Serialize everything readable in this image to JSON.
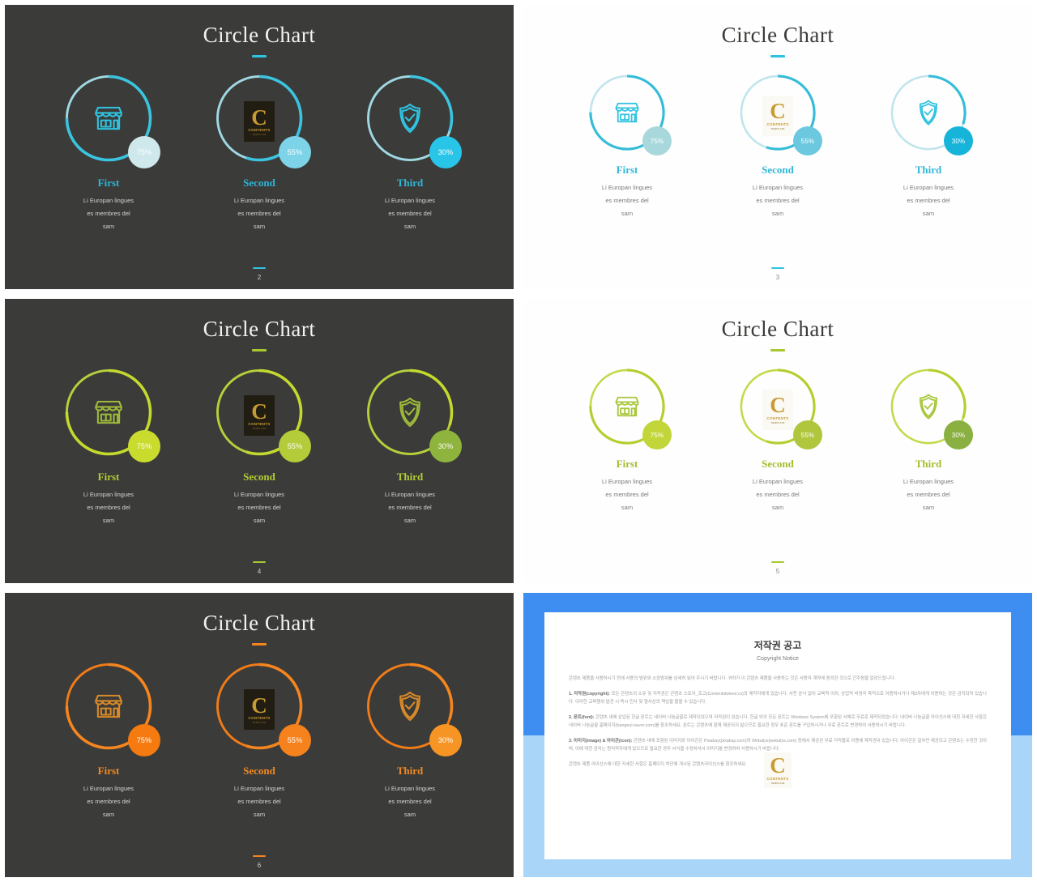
{
  "slides": [
    {
      "id": "slide-2-dark-cyan",
      "theme": "dark",
      "title": "Circle Chart",
      "accent": "#2fc3e0",
      "page": "2",
      "ring_track": "#9fd8e2",
      "ring_fill": "#3bc4e0",
      "name_color": "#2fb6d6",
      "icon_color": "#2fc3e0",
      "items": [
        {
          "name": "First",
          "percent": "75%",
          "icon": "storefront-icon",
          "badge": "#cfe8ec",
          "desc": [
            "Li Europan lingues",
            "es membres del",
            "sam"
          ]
        },
        {
          "name": "Second",
          "percent": "55%",
          "icon": "line-chart-icon",
          "badge": "#7dd3e8",
          "desc": [
            "Li Europan lingues",
            "es membres del",
            "sam"
          ]
        },
        {
          "name": "Third",
          "percent": "30%",
          "icon": "shield-check-icon",
          "badge": "#29c5e8",
          "desc": [
            "Li Europan lingues",
            "es membres del",
            "sam"
          ]
        }
      ]
    },
    {
      "id": "slide-3-light-cyan",
      "theme": "light",
      "title": "Circle Chart",
      "accent": "#2fc3e0",
      "page": "3",
      "ring_track": "#bfe5ec",
      "ring_fill": "#35bcd8",
      "name_color": "#33b8d8",
      "icon_color": "#2fc3e0",
      "items": [
        {
          "name": "First",
          "percent": "75%",
          "icon": "storefront-icon",
          "badge": "#a8d8dc",
          "desc": [
            "Li Europan lingues",
            "es membres del",
            "sam"
          ]
        },
        {
          "name": "Second",
          "percent": "55%",
          "icon": "line-chart-icon",
          "badge": "#6cc8de",
          "desc": [
            "Li Europan lingues",
            "es membres del",
            "sam"
          ]
        },
        {
          "name": "Third",
          "percent": "30%",
          "icon": "shield-check-icon",
          "badge": "#17b4da",
          "desc": [
            "Li Europan lingues",
            "es membres del",
            "sam"
          ]
        }
      ]
    },
    {
      "id": "slide-4-dark-green",
      "theme": "dark",
      "title": "Circle Chart",
      "accent": "#a8c832",
      "page": "4",
      "ring_track": "#b6cf3c",
      "ring_fill": "#c4d92e",
      "name_color": "#b3cc34",
      "icon_color": "#9db93a",
      "items": [
        {
          "name": "First",
          "percent": "75%",
          "icon": "storefront-icon",
          "badge": "#c9dc2e",
          "desc": [
            "Li Europan lingues",
            "es membres del",
            "sam"
          ]
        },
        {
          "name": "Second",
          "percent": "55%",
          "icon": "line-chart-icon",
          "badge": "#b4cb3a",
          "desc": [
            "Li Europan lingues",
            "es membres del",
            "sam"
          ]
        },
        {
          "name": "Third",
          "percent": "30%",
          "icon": "shield-check-icon",
          "badge": "#8fb43e",
          "desc": [
            "Li Europan lingues",
            "es membres del",
            "sam"
          ]
        }
      ]
    },
    {
      "id": "slide-5-light-green",
      "theme": "light",
      "title": "Circle Chart",
      "accent": "#a8c832",
      "page": "5",
      "ring_track": "#c3d94a",
      "ring_fill": "#b5cd2e",
      "name_color": "#a5bd2e",
      "icon_color": "#a8c63a",
      "items": [
        {
          "name": "First",
          "percent": "75%",
          "icon": "storefront-icon",
          "badge": "#c2d63a",
          "desc": [
            "Li Europan lingues",
            "es membres del",
            "sam"
          ]
        },
        {
          "name": "Second",
          "percent": "55%",
          "icon": "line-chart-icon",
          "badge": "#b0c63c",
          "desc": [
            "Li Europan lingues",
            "es membres del",
            "sam"
          ]
        },
        {
          "name": "Third",
          "percent": "30%",
          "icon": "shield-check-icon",
          "badge": "#89b040",
          "desc": [
            "Li Europan lingues",
            "es membres del",
            "sam"
          ]
        }
      ]
    },
    {
      "id": "slide-6-dark-orange",
      "theme": "dark",
      "title": "Circle Chart",
      "accent": "#f5851f",
      "page": "6",
      "ring_track": "#f07c18",
      "ring_fill": "#f5851f",
      "name_color": "#f08a22",
      "icon_color": "#d88a28",
      "items": [
        {
          "name": "First",
          "percent": "75%",
          "icon": "storefront-icon",
          "badge": "#f57a10",
          "desc": [
            "Li Europan lingues",
            "es membres del",
            "sam"
          ]
        },
        {
          "name": "Second",
          "percent": "55%",
          "icon": "line-chart-icon",
          "badge": "#f5821c",
          "desc": [
            "Li Europan lingues",
            "es membres del",
            "sam"
          ]
        },
        {
          "name": "Third",
          "percent": "30%",
          "icon": "shield-check-icon",
          "badge": "#f79524",
          "desc": [
            "Li Europan lingues",
            "es membres del",
            "sam"
          ]
        }
      ]
    }
  ],
  "watermark": {
    "letter": "C",
    "line1": "CONTENTS",
    "line2": "TEMPLATE"
  },
  "copyright": {
    "border_top_color": "#3d8ef0",
    "border_bottom_color": "#a8d5f8",
    "title": "저작권 공고",
    "subtitle": "Copyright Notice",
    "paragraphs": [
      "콘텐츠 제품을 사용하시기 전에 사용의 범위와 소장범위를 상세히 읽어 주시기 바랍니다. 귀하가 이 콘텐츠 제품을 사용하는 것은 사용자 계약에 동의한 것으로 간주됨을 알려드립니다.",
      "<b>1. 저작권(copyright):</b> 모든 콘텐츠의 소유 및 저작권은 콘텐츠 스토어_로고(Contentstokeor.ru)의 제작자에게 있습니다. 사전 승낙 없이 교육적 이외, 상업적 비영리 목적으로 이용하시거나 제3자에게 이용하는 것은 금지되어 있습니다. 이러한 교육행위 발견 시 즉시 민사 및 형사상의 책임을 물을 수 있습니다.",
      "<b>2. 폰트(font):</b> 콘텐츠 내에 삽입된 한글 폰트는 네이버 나눔글꼴로 제작되었으며 저작권이 있습니다. 한글 외의 모든 폰트는 Windows System에 포함된 서체로 무료로 제작되었습니다. 네이버 나눔글꼴 라이선스에 대한 자세한 사항은 네이버 나눔글꼴 홈페이지(hangeul.naver.com)를 참조하세요. 폰트는 콘텐츠에 함께 제공되지 않으므로 필요한 경우 표준 폰트를 구입하시거나 무료 폰트로 변경하여 사용하시기 바랍니다.",
      "<b>3. 이미지(image) &amp; 아이콘(icon):</b> 콘텐츠 내에 포함된 이미지와 아이콘은 Pixabay(pixabay.com)와 Webalys(webalys.com) 등에서 제공된 무료 저작물로 이용에 제작권이 있습니다. 아이콘은 일부만 제공되고 콘텐츠는 수정한 것이며, 이에 대한 권리는 원저작자에게 있으므로 필요한 경우 서식을 수정하셔서 이미지를 변경하여 사용하시기 바랍니다.",
      "콘텐츠 제품 라이선스에 대한 자세한 사항은 홈페이지 하단에 게시된 콘텐츠라이선스를 참조하세요."
    ]
  }
}
